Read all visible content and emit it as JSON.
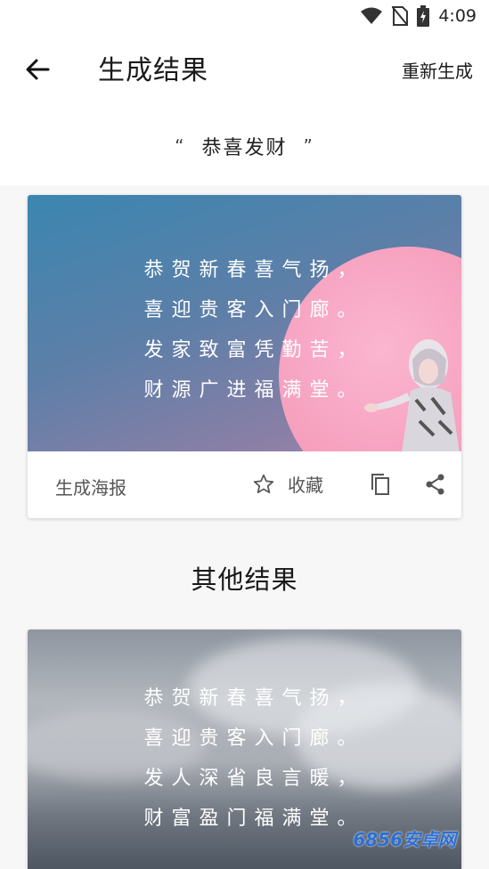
{
  "status": {
    "time": "4:09"
  },
  "appbar": {
    "title": "生成结果",
    "regenerate_label": "重新生成"
  },
  "query": {
    "open_quote": "“",
    "text": "恭喜发财",
    "close_quote": "”"
  },
  "result_card": {
    "poem": [
      "恭贺新春喜气扬，",
      "喜迎贵客入门廊。",
      "发家致富凭勤苦，",
      "财源广进福满堂。"
    ],
    "actions": {
      "generate_poster": "生成海报",
      "favorite": "收藏"
    }
  },
  "others": {
    "title": "其他结果",
    "cards": [
      {
        "poem": [
          "恭贺新春喜气扬，",
          "喜迎贵客入门廊。",
          "发人深省良言暖，",
          "财富盈门福满堂。"
        ]
      }
    ]
  },
  "watermark": "6856安卓网",
  "colors": {
    "background": "#f7f7f7",
    "poster_pink": "#f49ab9",
    "poster_blue": "#3a86b0"
  }
}
